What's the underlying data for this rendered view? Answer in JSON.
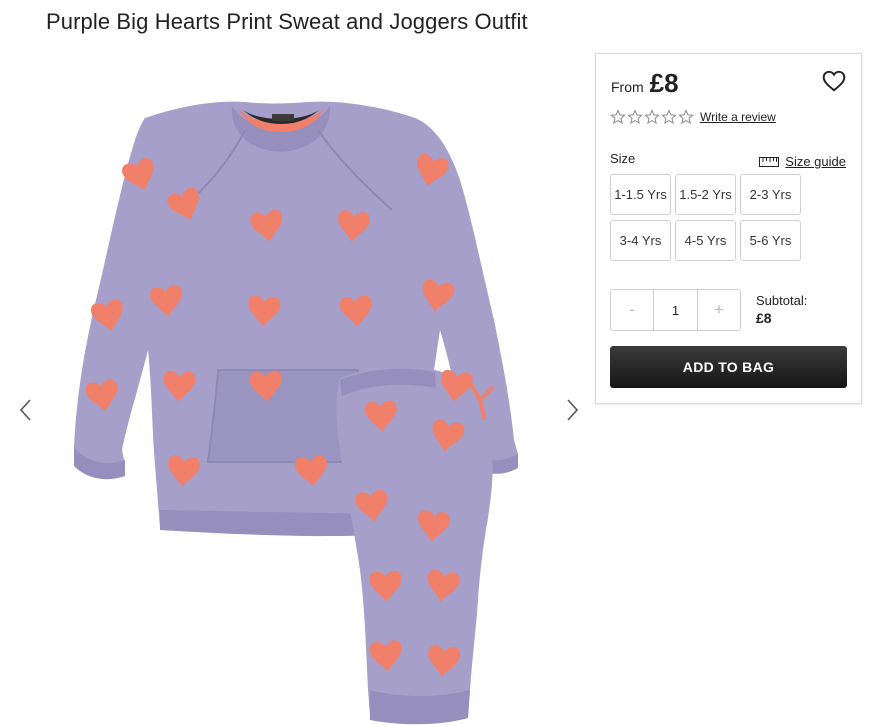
{
  "product": {
    "title": "Purple Big Hearts Print Sweat and Joggers Outfit",
    "price_prefix": "From",
    "price": "£8",
    "write_review": "Write a review",
    "size_label": "Size",
    "size_guide": "Size guide",
    "sizes": [
      "1-1.5 Yrs",
      "1.5-2 Yrs",
      "2-3 Yrs",
      "3-4 Yrs",
      "4-5 Yrs",
      "5-6 Yrs"
    ],
    "quantity": "1",
    "qty_minus": "-",
    "qty_plus": "+",
    "subtotal_label": "Subtotal:",
    "subtotal_value": "£8",
    "add_to_bag": "ADD TO BAG"
  },
  "colors": {
    "garment": "#a59fc9",
    "heart": "#f0806a",
    "cuff": "#968fbd",
    "button": "#1f1f1f"
  },
  "icons": [
    "chevron-left-icon",
    "chevron-right-icon",
    "heart-outline-icon",
    "star-outline-icon",
    "ruler-icon"
  ]
}
